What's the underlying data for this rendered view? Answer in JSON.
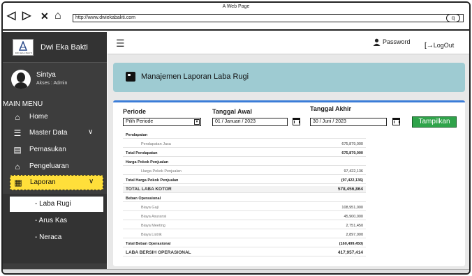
{
  "window": {
    "title": "A Web Page",
    "url": "http://www.dwiekabakti.com"
  },
  "brand": {
    "name": "Dwi Eka Bakti",
    "logo_text": "DWI EKA BAKTI"
  },
  "user": {
    "name": "Sintya",
    "role": "Akses : Admin"
  },
  "menu": {
    "title": "MAIN MENU",
    "items": [
      {
        "label": "Home",
        "icon": "home-icon"
      },
      {
        "label": "Master Data",
        "icon": "database-icon",
        "chevron": "∨"
      },
      {
        "label": "Pemasukan",
        "icon": "wallet-icon"
      },
      {
        "label": "Pengeluaran",
        "icon": "basket-icon"
      },
      {
        "label": "Laporan",
        "icon": "report-icon",
        "chevron": "∨"
      }
    ],
    "submenu": [
      "- Laba Rugi",
      "- Arus Kas",
      "- Neraca"
    ]
  },
  "topbar": {
    "password": "Password",
    "logout": "LogOut"
  },
  "page": {
    "title": "Manajemen Laporan Laba Rugi"
  },
  "filters": {
    "periode_label": "Periode",
    "periode_value": "Pilih Periode",
    "start_label": "Tanggal Awal",
    "start_value": "01 / Januari / 2023",
    "end_label": "Tanggal Akhir",
    "end_value": "30 / Juni / 2023",
    "submit": "Tampilkan"
  },
  "report": [
    {
      "label": "Pendapatan",
      "value": "",
      "style": "bold"
    },
    {
      "label": "Pendapatan Jasa",
      "value": "675,879,000",
      "style": "sub"
    },
    {
      "label": "Total Pendapatan",
      "value": "675,879,000",
      "style": "bold"
    },
    {
      "label": "Harga Pokok Penjualan",
      "value": "",
      "style": "bold"
    },
    {
      "label": "Harga Pokok Penjualan",
      "value": "97,422,136",
      "style": "sub"
    },
    {
      "label": "Total Harga Pokok Penjualan",
      "value": "(97,422,136)",
      "style": "bold"
    },
    {
      "label": "TOTAL LABA KOTOR",
      "value": "578,456,864",
      "style": "big shade"
    },
    {
      "label": "Beban Operasional",
      "value": "",
      "style": "bold"
    },
    {
      "label": "Biaya Gaji",
      "value": "108,951,000",
      "style": "sub"
    },
    {
      "label": "Biaya Asuransi",
      "value": "45,900,000",
      "style": "sub"
    },
    {
      "label": "Biaya Meeting",
      "value": "2,751,450",
      "style": "sub"
    },
    {
      "label": "Biaya Listrik",
      "value": "2,897,000",
      "style": "sub"
    },
    {
      "label": "Total Beban Operasional",
      "value": "(160,499,450)",
      "style": "bold"
    },
    {
      "label": "LABA BERSIH OPERASIONAL",
      "value": "417,957,414",
      "style": "big"
    }
  ]
}
